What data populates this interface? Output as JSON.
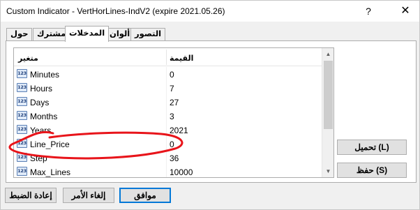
{
  "window": {
    "title": "Custom Indicator - VertHorLines-IndV2 (expire 2021.05.26)",
    "help_glyph": "?",
    "close_glyph": "✕"
  },
  "tabs": [
    {
      "label": "حول",
      "active": false
    },
    {
      "label": "مشترك",
      "active": false
    },
    {
      "label": "المدخلات",
      "active": true
    },
    {
      "label": "ألوان",
      "active": false
    },
    {
      "label": "التصور",
      "active": false
    }
  ],
  "table": {
    "header": {
      "name": "متغير",
      "value": "القيمة"
    },
    "icon_text": "123",
    "rows": [
      {
        "name": "Minutes",
        "value": "0"
      },
      {
        "name": "Hours",
        "value": "7"
      },
      {
        "name": "Days",
        "value": "27"
      },
      {
        "name": "Months",
        "value": "3"
      },
      {
        "name": "Years",
        "value": "2021"
      },
      {
        "name": "Line_Price",
        "value": "0"
      },
      {
        "name": "Step",
        "value": "36"
      },
      {
        "name": "Max_Lines",
        "value": "10000"
      }
    ]
  },
  "scrollbar": {
    "up_glyph": "▲",
    "down_glyph": "▼"
  },
  "side_buttons": {
    "load": "تحميل (L)",
    "save": "حفظ (S)"
  },
  "footer": {
    "reset": "إعادة الضبط",
    "cancel": "إلغاء الأمر",
    "ok": "موافق"
  },
  "colors": {
    "annotation": "#e8141a",
    "focus": "#0078d7"
  }
}
